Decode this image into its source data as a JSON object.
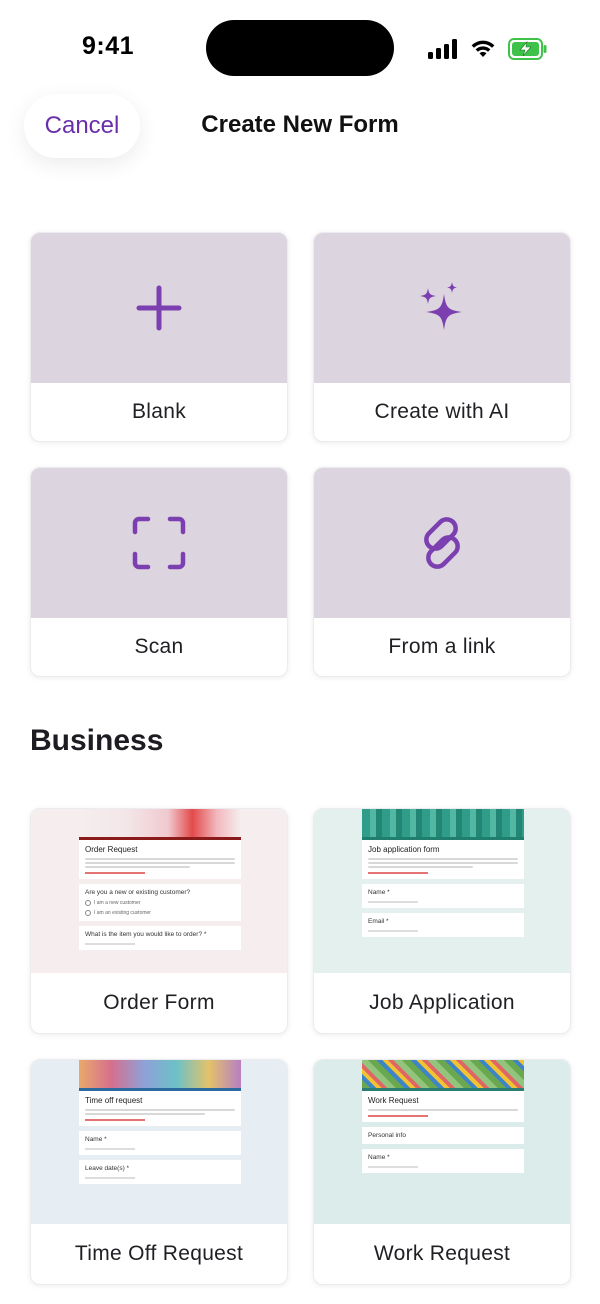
{
  "status_bar": {
    "time": "9:41"
  },
  "header": {
    "cancel_label": "Cancel",
    "title": "Create New Form"
  },
  "create_options": [
    {
      "label": "Blank",
      "icon": "plus-icon"
    },
    {
      "label": "Create with AI",
      "icon": "sparkles-icon"
    },
    {
      "label": "Scan",
      "icon": "scan-frame-icon"
    },
    {
      "label": "From a link",
      "icon": "link-icon"
    }
  ],
  "section": {
    "title": "Business"
  },
  "templates": [
    {
      "label": "Order Form",
      "preview_title": "Order Request",
      "preview_q1": "Are you a new or existing customer?",
      "preview_q2": "What is the item you would like to order? *",
      "opt1": "I am a new customer",
      "opt2": "I am an existing customer"
    },
    {
      "label": "Job Application",
      "preview_title": "Job application form",
      "preview_q1": "Name *",
      "preview_q2": "Email *"
    },
    {
      "label": "Time Off Request",
      "preview_title": "Time off request",
      "preview_q1": "Name *",
      "preview_q2": "Leave date(s) *"
    },
    {
      "label": "Work Request",
      "preview_title": "Work Request",
      "preview_q1": "Personal info",
      "preview_q2": "Name *"
    }
  ],
  "colors": {
    "accent": "#6a2fa8",
    "icon_purple": "#7b3fb0",
    "tile_bg": "#dcd4df"
  }
}
